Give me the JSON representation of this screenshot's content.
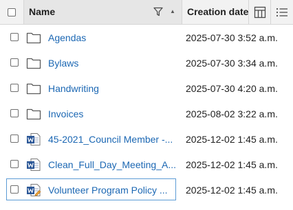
{
  "header": {
    "name_label": "Name",
    "date_label": "Creation date",
    "filter_icon": "filter-icon",
    "sort_icon": "sort-ascending-icon",
    "columns_icon": "columns-icon",
    "menu_icon": "list-menu-icon",
    "sort_glyph": "▲"
  },
  "rows": [
    {
      "type": "folder",
      "icon": "folder-icon",
      "name": "Agendas",
      "date": "2025-07-30 3:52 a.m."
    },
    {
      "type": "folder",
      "icon": "folder-icon",
      "name": "Bylaws",
      "date": "2025-07-30 3:34 a.m."
    },
    {
      "type": "folder",
      "icon": "folder-icon",
      "name": "Handwriting",
      "date": "2025-07-30 4:20 a.m."
    },
    {
      "type": "folder",
      "icon": "folder-icon",
      "name": "Invoices",
      "date": "2025-08-02 3:22 a.m."
    },
    {
      "type": "word",
      "icon": "word-document-icon",
      "name": "45-2021_Council Member -...",
      "date": "2025-12-02 1:45 a.m."
    },
    {
      "type": "word",
      "icon": "word-document-icon",
      "name": "Clean_Full_Day_Meeting_A...",
      "date": "2025-12-02 1:45 a.m."
    },
    {
      "type": "word",
      "icon": "word-document-edit-icon",
      "name": "Volunteer Program Policy ...",
      "date": "2025-12-02 1:45 a.m.",
      "selected": true
    }
  ],
  "colors": {
    "link": "#1b67b3",
    "header_bg": "#f2f2f2",
    "name_header_bg": "#e6e6e6",
    "word_blue": "#2b5797",
    "selection_border": "#5b9bd5"
  }
}
